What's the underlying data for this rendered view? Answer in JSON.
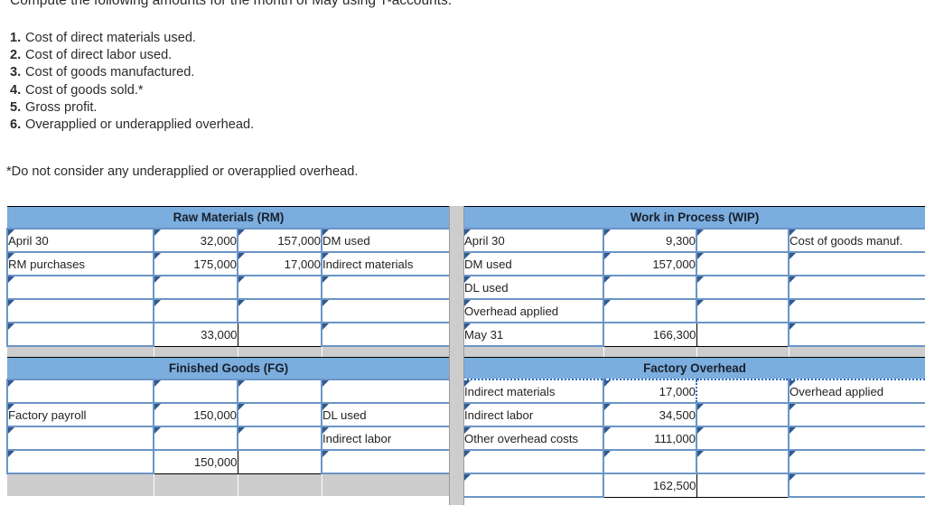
{
  "intro": "Compute the following amounts for the month of May using T-accounts.",
  "requirements": [
    {
      "num": "1.",
      "text": "Cost of direct materials used."
    },
    {
      "num": "2.",
      "text": "Cost of direct labor used."
    },
    {
      "num": "3.",
      "text": "Cost of goods manufactured."
    },
    {
      "num": "4.",
      "text": "Cost of goods sold.*"
    },
    {
      "num": "5.",
      "text": "Gross profit."
    },
    {
      "num": "6.",
      "text": "Overapplied or underapplied overhead."
    }
  ],
  "footnote": "*Do not consider any underapplied or overapplied overhead.",
  "colors": {
    "header_blue": "#7badde",
    "grid_blue": "#6a95c6",
    "spacer_gray": "#cdcdcd",
    "selection_blue": "#2f6fc0",
    "corner_flag": "#31598f"
  },
  "accounts": {
    "raw_materials": {
      "title": "Raw Materials (RM)",
      "rows": [
        {
          "debit_label": "April 30",
          "debit_amount": "32,000",
          "credit_amount": "157,000",
          "credit_label": "DM used"
        },
        {
          "debit_label": "RM purchases",
          "debit_amount": "175,000",
          "credit_amount": "17,000",
          "credit_label": "Indirect materials"
        },
        {
          "debit_label": "",
          "debit_amount": "",
          "credit_amount": "",
          "credit_label": ""
        },
        {
          "debit_label": "",
          "debit_amount": "",
          "credit_amount": "",
          "credit_label": ""
        },
        {
          "debit_label": "",
          "debit_amount": "33,000",
          "credit_amount": "",
          "credit_label": ""
        }
      ]
    },
    "work_in_process": {
      "title": "Work in Process (WIP)",
      "rows": [
        {
          "debit_label": "April 30",
          "debit_amount": "9,300",
          "credit_amount": "",
          "credit_label": "Cost of goods manuf."
        },
        {
          "debit_label": "DM used",
          "debit_amount": "157,000",
          "credit_amount": "",
          "credit_label": ""
        },
        {
          "debit_label": "DL used",
          "debit_amount": "",
          "credit_amount": "",
          "credit_label": ""
        },
        {
          "debit_label": "Overhead applied",
          "debit_amount": "",
          "credit_amount": "",
          "credit_label": ""
        },
        {
          "debit_label": "May 31",
          "debit_amount": "166,300",
          "credit_amount": "",
          "credit_label": ""
        }
      ]
    },
    "finished_goods": {
      "title": "Finished Goods (FG)",
      "rows": [
        {
          "debit_label": "",
          "debit_amount": "",
          "credit_amount": "",
          "credit_label": ""
        },
        {
          "debit_label": "Factory payroll",
          "debit_amount": "150,000",
          "credit_amount": "",
          "credit_label": "DL used"
        },
        {
          "debit_label": "",
          "debit_amount": "",
          "credit_amount": "",
          "credit_label": "Indirect labor"
        },
        {
          "debit_label": "",
          "debit_amount": "150,000",
          "credit_amount": "",
          "credit_label": ""
        }
      ]
    },
    "factory_overhead": {
      "title": "Factory Overhead",
      "rows": [
        {
          "debit_label": "Indirect materials",
          "debit_amount": "17,000",
          "credit_amount": "",
          "credit_label": "Overhead applied"
        },
        {
          "debit_label": "Indirect labor",
          "debit_amount": "34,500",
          "credit_amount": "",
          "credit_label": ""
        },
        {
          "debit_label": "Other overhead costs",
          "debit_amount": "111,000",
          "credit_amount": "",
          "credit_label": ""
        },
        {
          "debit_label": "",
          "debit_amount": "",
          "credit_amount": "",
          "credit_label": ""
        },
        {
          "debit_label": "",
          "debit_amount": "162,500",
          "credit_amount": "",
          "credit_label": ""
        }
      ]
    }
  }
}
